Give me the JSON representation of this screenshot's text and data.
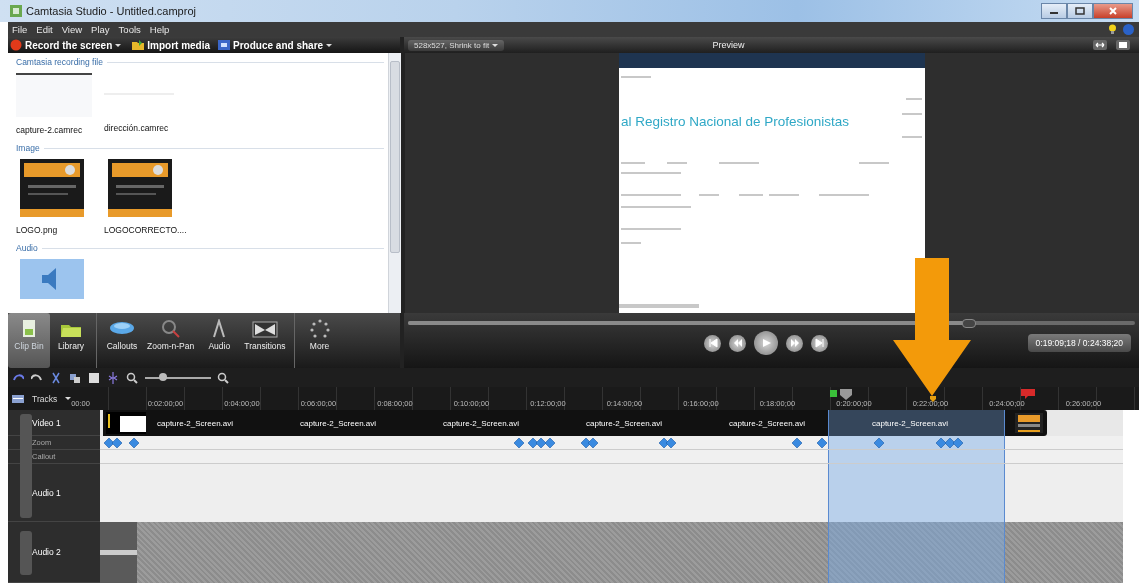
{
  "window": {
    "title": "Camtasia Studio - Untitled.camproj"
  },
  "menu": [
    "File",
    "Edit",
    "View",
    "Play",
    "Tools",
    "Help"
  ],
  "toolbar": [
    {
      "label": "Record the screen",
      "kind": "record",
      "dropdown": true
    },
    {
      "label": "Import media",
      "kind": "import",
      "dropdown": false
    },
    {
      "label": "Produce and share",
      "kind": "produce",
      "dropdown": true
    }
  ],
  "clip_bin": {
    "sections": [
      {
        "title": "Camtasia recording file",
        "items": [
          {
            "name": "capture-2.camrec",
            "kind": "recording"
          },
          {
            "name": "dirección.camrec",
            "kind": "blank"
          }
        ]
      },
      {
        "title": "Image",
        "items": [
          {
            "name": "LOGO.png",
            "kind": "image"
          },
          {
            "name": "LOGOCORRECTO....",
            "kind": "image"
          }
        ]
      },
      {
        "title": "Audio",
        "items": [
          {
            "kind": "audio"
          }
        ]
      }
    ]
  },
  "preview": {
    "size_dropdown": "528x527, Shrink to fit",
    "title": "Preview",
    "page_heading": "al Registro Nacional de Profesionistas",
    "scrub": {
      "level": 0.77
    },
    "time": "0:19:09;18 / 0:24:38;20"
  },
  "tasks": [
    {
      "label": "Clip Bin",
      "kind": "clipbin",
      "selected": true
    },
    {
      "label": "Library",
      "kind": "library",
      "selected": false
    },
    {
      "label": "Callouts",
      "kind": "callouts",
      "selected": false
    },
    {
      "label": "Zoom-n-Pan",
      "kind": "zoom",
      "selected": false
    },
    {
      "label": "Audio",
      "kind": "audio",
      "selected": false
    },
    {
      "label": "Transitions",
      "kind": "transitions",
      "selected": false
    },
    {
      "label": "More",
      "kind": "more",
      "selected": false
    }
  ],
  "timeline": {
    "zoom_slider": {
      "level": 0.27
    },
    "tracks_button": "Tracks",
    "ruler": [
      "00:00",
      "0:02:00;00",
      "0:04:00;00",
      "0:06:00;00",
      "0:08:00;00",
      "0:10:00;00",
      "0:12:00;00",
      "0:14:00;00",
      "0:16:00;00",
      "0:18:00;00",
      "0:20:00;00",
      "0:22:00;00",
      "0:24:00;00",
      "0:26:00;00"
    ],
    "tracks": [
      {
        "name": "Video 1",
        "kind": "video",
        "clips": [
          "capture-2_Screen.avi",
          "capture-2_Screen.avi",
          "capture-2_Screen.avi",
          "capture-2_Screen.avi",
          "capture-2_Screen.avi",
          "capture-2_Screen.avi"
        ]
      },
      {
        "name": "Zoom",
        "kind": "zoom"
      },
      {
        "name": "Callout",
        "kind": "callout"
      },
      {
        "name": "Audio 1",
        "kind": "audio"
      },
      {
        "name": "Audio 2",
        "kind": "audio2"
      }
    ]
  }
}
